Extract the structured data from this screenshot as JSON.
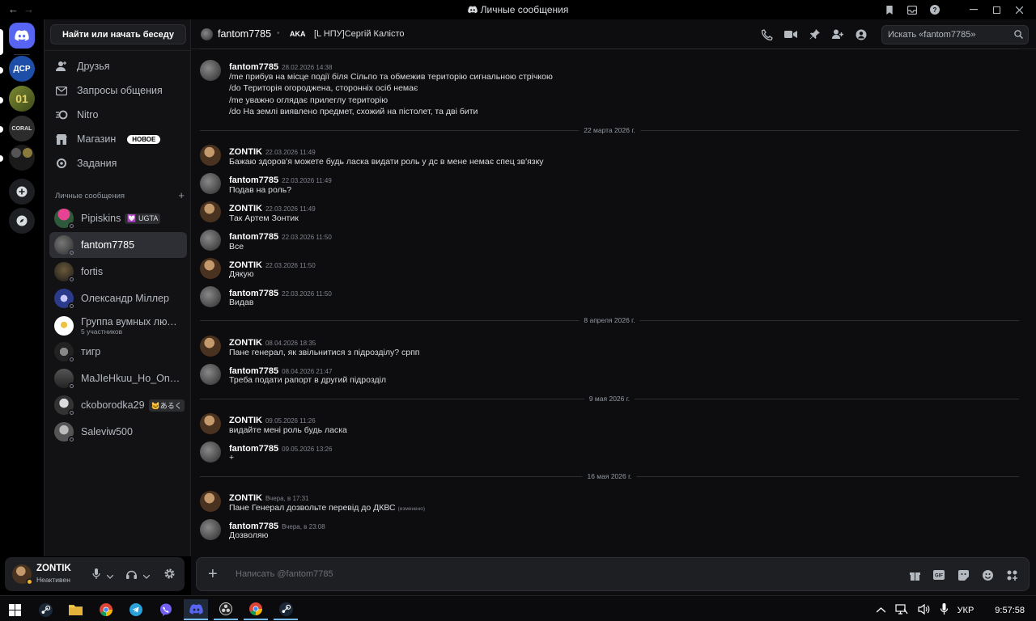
{
  "titlebar": {
    "title": "Личные сообщения",
    "back": "←",
    "forward": "→"
  },
  "servers": [
    {
      "label": "ДСР",
      "color": "#1d4fa8"
    },
    {
      "label": "",
      "color": "#5f6b2f"
    },
    {
      "label": "CORAL",
      "color": "#333"
    },
    {
      "label": "",
      "color": "#2a2a2a"
    }
  ],
  "sidebar": {
    "search_label": "Найти или начать беседу",
    "nav": [
      {
        "label": "Друзья"
      },
      {
        "label": "Запросы общения"
      },
      {
        "label": "Nitro"
      },
      {
        "label": "Магазин",
        "badge": "НОВОЕ"
      },
      {
        "label": "Задания"
      }
    ],
    "dm_header": "Личные сообщения",
    "dms": [
      {
        "name": "Pipiskins",
        "tag": "💟 UGTA"
      },
      {
        "name": "fantom7785"
      },
      {
        "name": "fortis"
      },
      {
        "name": "Олександр Міллер"
      },
      {
        "name": "Группа вумных людей",
        "sub": "5 участников"
      },
      {
        "name": "тигр"
      },
      {
        "name": "MaJIeHkuu_Ho_Onac..."
      },
      {
        "name": "ckoborodka29",
        "tag": "🐱あるく"
      },
      {
        "name": "Saleviw500"
      }
    ]
  },
  "user": {
    "name": "ZONTIK",
    "status": "Неактивен"
  },
  "header": {
    "name": "fantom7785",
    "aka": "AKA",
    "nick": "[L НПУ]Сергій Калісто",
    "search_placeholder": "Искать «fantom7785»"
  },
  "messages": [
    {
      "author": "fantom7785",
      "time": "28.02.2026 14:38",
      "lines": [
        "/me прибув на місце події біля Сільпо та обмежив територію сигнальною стрічкою",
        "/do Територія огороджена, сторонніх осіб немає",
        "/me уважно оглядає прилеглу територію",
        "/do На землі виявлено предмет, схожий на пістолет, та дві бити"
      ]
    },
    {
      "author": "ZONTIK",
      "time": "22.03.2026 11:49",
      "lines": [
        "Бажаю здоров'я можете будь ласка видати роль у дс в мене немає спец зв'язку"
      ]
    },
    {
      "author": "fantom7785",
      "time": "22.03.2026 11:49",
      "lines": [
        "Подав на роль?"
      ]
    },
    {
      "author": "ZONTIK",
      "time": "22.03.2026 11:49",
      "lines": [
        "Так Артем Зонтик"
      ]
    },
    {
      "author": "fantom7785",
      "time": "22.03.2026 11:50",
      "lines": [
        "Все"
      ]
    },
    {
      "author": "ZONTIK",
      "time": "22.03.2026 11:50",
      "lines": [
        "Дякую"
      ]
    },
    {
      "author": "fantom7785",
      "time": "22.03.2026 11:50",
      "lines": [
        "Видав"
      ]
    },
    {
      "author": "ZONTIK",
      "time": "08.04.2026 18:35",
      "lines": [
        "Пане генерал, як звільнитися з підрозділу? српп"
      ]
    },
    {
      "author": "fantom7785",
      "time": "08.04.2026 21:47",
      "lines": [
        "Треба подати рапорт в другий підрозділ"
      ]
    },
    {
      "author": "ZONTIK",
      "time": "09.05.2026 11:26",
      "lines": [
        "видайте мені роль будь ласка"
      ]
    },
    {
      "author": "fantom7785",
      "time": "09.05.2026 13:26",
      "lines": [
        "+"
      ]
    },
    {
      "author": "ZONTIK",
      "time": "Вчера, в 17:31",
      "lines": [
        "Пане Генерал дозвольте перевід до ДКВС"
      ],
      "edited": "(изменено)"
    },
    {
      "author": "fantom7785",
      "time": "Вчера, в 23:08",
      "lines": [
        "Дозволяю"
      ]
    }
  ],
  "dividers": [
    "22 марта 2026 г.",
    "8 апреля 2026 г.",
    "9 мая 2026 г.",
    "16 мая 2026 г."
  ],
  "composer": {
    "placeholder": "Написать @fantom7785"
  },
  "taskbar": {
    "lang": "УКР",
    "time": "9:57:58"
  },
  "colors": {
    "accent": "#5865f2",
    "zontik_avatar": "#6b4a2a",
    "fantom_avatar": "#3a3a3c"
  }
}
